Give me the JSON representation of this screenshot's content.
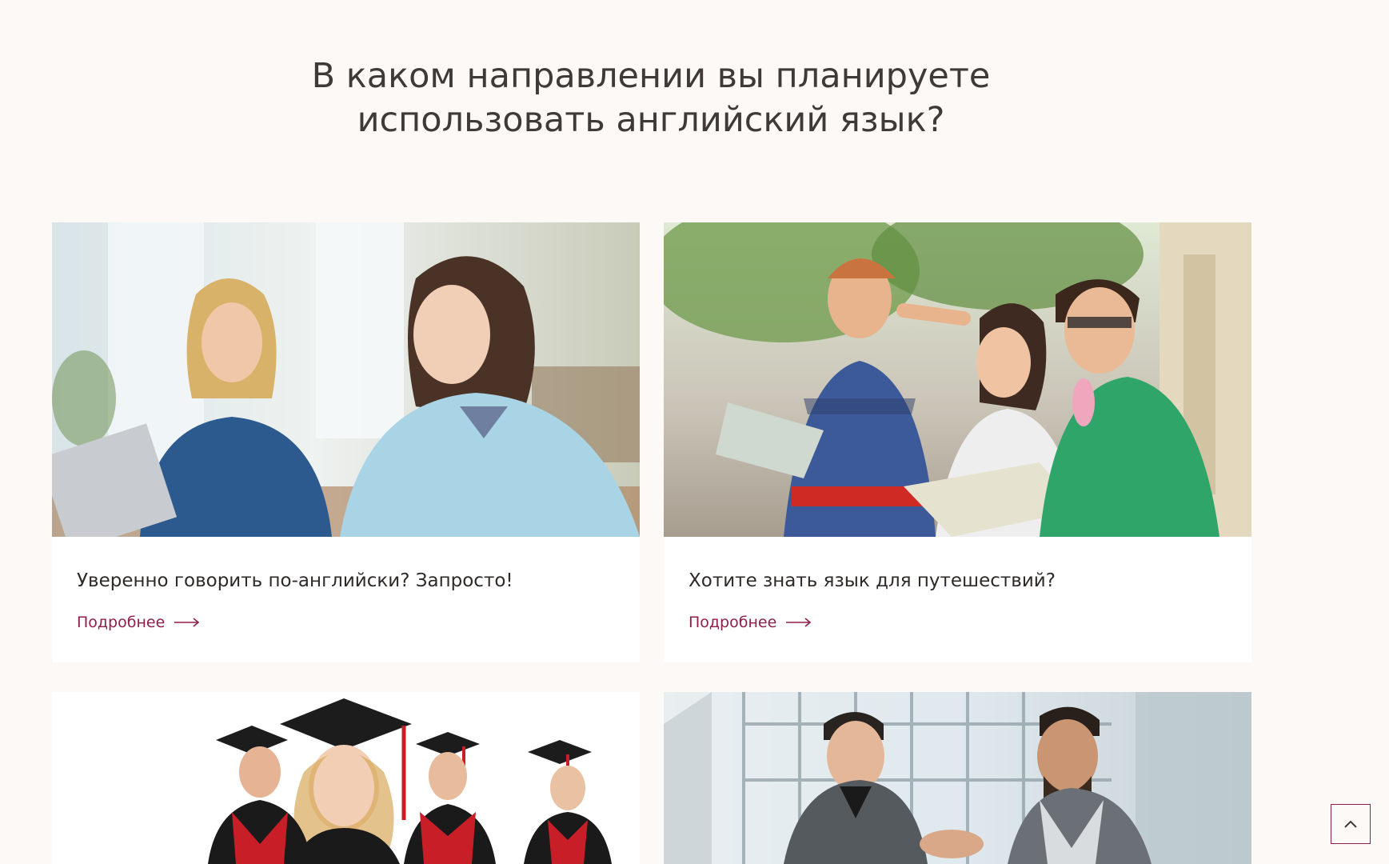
{
  "section": {
    "title_line1": "В каком направлении вы планируете",
    "title_line2": "использовать английский язык?"
  },
  "cards": [
    {
      "image": "students-smiling-photo",
      "text": "Уверенно говорить по-английски? Запросто!",
      "link": "Подробнее"
    },
    {
      "image": "travelers-with-map-photo",
      "text": "Хотите знать язык для путешествий?",
      "link": "Подробнее"
    },
    {
      "image": "graduates-in-caps-photo"
    },
    {
      "image": "business-handshake-photo"
    }
  ],
  "colors": {
    "background": "#fcf9f7",
    "accent": "#8e1f4a",
    "text": "#3f3a37"
  },
  "icons": {
    "link_arrow": "long-arrow-right-icon",
    "scroll_top": "chevron-up-icon"
  }
}
